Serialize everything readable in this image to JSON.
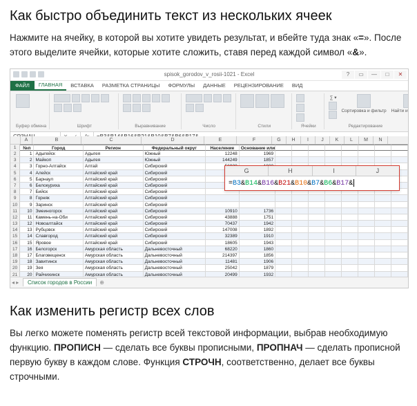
{
  "article": {
    "h1": "Как быстро объединить текст из нескольких ячеек",
    "p1_a": "Нажмите на ячейку, в которой вы хотите увидеть результат, и вбейте туда знак «",
    "p1_eq": "=",
    "p1_b": "». После этого выделите ячейки, которые хотите сложить, ставя перед каждой символ «",
    "p1_amp": "&",
    "p1_c": "».",
    "h2": "Как изменить регистр всех слов",
    "p2_a": "Вы легко можете поменять регистр всей текстовой информации, выбрав необходимую функцию. ",
    "p2_f1": "ПРОПИСН",
    "p2_b": " — сделать все буквы прописными, ",
    "p2_f2": "ПРОПНАЧ",
    "p2_c": " — сделать прописной первую букву в каждом слове. Функция ",
    "p2_f3": "СТРОЧН",
    "p2_d": ", соответственно, делает все буквы строчными."
  },
  "excel": {
    "window_title": "spisok_gorodov_v_rosii-1021 - Excel",
    "tabs": {
      "file": "ФАЙЛ",
      "items": [
        "ГЛАВНАЯ",
        "ВСТАВКА",
        "РАЗМЕТКА СТРАНИЦЫ",
        "ФОРМУЛЫ",
        "ДАННЫЕ",
        "РЕЦЕНЗИРОВАНИЕ",
        "ВИД"
      ],
      "active_index": 0
    },
    "ribbon_groups": [
      "Буфер обмена",
      "Шрифт",
      "Выравнивание",
      "Число",
      "Стили",
      "Ячейки",
      "Редактирование"
    ],
    "ribbon_hints": {
      "sort": "Сортировка и фильтр",
      "find": "Найти и выделить"
    },
    "name_box": "СРЗНАЧ",
    "fx": "fx",
    "formula_bar": "=B3&B14&B16&B21&B10&B7&B6&B17&",
    "sheet_tab": "Список городов в России",
    "columns": [
      "A",
      "B",
      "C",
      "D",
      "E",
      "F",
      "G",
      "H",
      "I",
      "J",
      "K",
      "L",
      "M",
      "N"
    ],
    "headers": {
      "A": "№п",
      "B": "Город",
      "C": "Регион",
      "D": "Федеральный округ",
      "E": "Население",
      "F": "Основание или первое упоминание"
    },
    "rows": [
      {
        "n": "1",
        "b": "Адыгейск",
        "c": "Адыгея",
        "d": "Южный",
        "e": "12248",
        "f": "1969"
      },
      {
        "n": "2",
        "b": "Майкоп",
        "c": "Адыгея",
        "d": "Южный",
        "e": "144249",
        "f": "1857"
      },
      {
        "n": "3",
        "b": "Горно-Алтайск",
        "c": "Алтай",
        "d": "Сибирский",
        "e": "56928",
        "f": "1830"
      },
      {
        "n": "4",
        "b": "Алейск",
        "c": "Алтайский край",
        "d": "Сибирский",
        "e": "",
        "f": ""
      },
      {
        "n": "5",
        "b": "Барнаул",
        "c": "Алтайский край",
        "d": "Сибирский",
        "e": "",
        "f": ""
      },
      {
        "n": "6",
        "b": "Белокуриха",
        "c": "Алтайский край",
        "d": "Сибирский",
        "e": "",
        "f": ""
      },
      {
        "n": "7",
        "b": "Бийск",
        "c": "Алтайский край",
        "d": "Сибирский",
        "e": "",
        "f": ""
      },
      {
        "n": "8",
        "b": "Горняк",
        "c": "Алтайский край",
        "d": "Сибирский",
        "e": "",
        "f": ""
      },
      {
        "n": "9",
        "b": "Заринск",
        "c": "Алтайский край",
        "d": "Сибирский",
        "e": "",
        "f": ""
      },
      {
        "n": "10",
        "b": "Змеиногорск",
        "c": "Алтайский край",
        "d": "Сибирский",
        "e": "10910",
        "f": "1736"
      },
      {
        "n": "11",
        "b": "Камень-на-Оби",
        "c": "Алтайский край",
        "d": "Сибирский",
        "e": "43888",
        "f": "1751"
      },
      {
        "n": "12",
        "b": "Новоалтайск",
        "c": "Алтайский край",
        "d": "Сибирский",
        "e": "70437",
        "f": "1942"
      },
      {
        "n": "13",
        "b": "Рубцовск",
        "c": "Алтайский край",
        "d": "Сибирский",
        "e": "147008",
        "f": "1892"
      },
      {
        "n": "14",
        "b": "Славгород",
        "c": "Алтайский край",
        "d": "Сибирский",
        "e": "32389",
        "f": "1910"
      },
      {
        "n": "15",
        "b": "Яровое",
        "c": "Алтайский край",
        "d": "Сибирский",
        "e": "18605",
        "f": "1943"
      },
      {
        "n": "16",
        "b": "Белогорск",
        "c": "Амурская область",
        "d": "Дальневосточный",
        "e": "68220",
        "f": "1860"
      },
      {
        "n": "17",
        "b": "Благовещенск",
        "c": "Амурская область",
        "d": "Дальневосточный",
        "e": "214397",
        "f": "1856"
      },
      {
        "n": "18",
        "b": "Завитинск",
        "c": "Амурская область",
        "d": "Дальневосточный",
        "e": "11481",
        "f": "1906"
      },
      {
        "n": "19",
        "b": "Зея",
        "c": "Амурская область",
        "d": "Дальневосточный",
        "e": "25042",
        "f": "1879"
      },
      {
        "n": "20",
        "b": "Райчихинск",
        "c": "Амурская область",
        "d": "Дальневосточный",
        "e": "20499",
        "f": "1932"
      }
    ],
    "popup": {
      "headers": [
        "G",
        "H",
        "I",
        "J"
      ],
      "refs": [
        "B3",
        "B14",
        "B16",
        "B21",
        "B10",
        "B7",
        "B6",
        "B17"
      ],
      "amp": "&",
      "eq": "="
    }
  }
}
